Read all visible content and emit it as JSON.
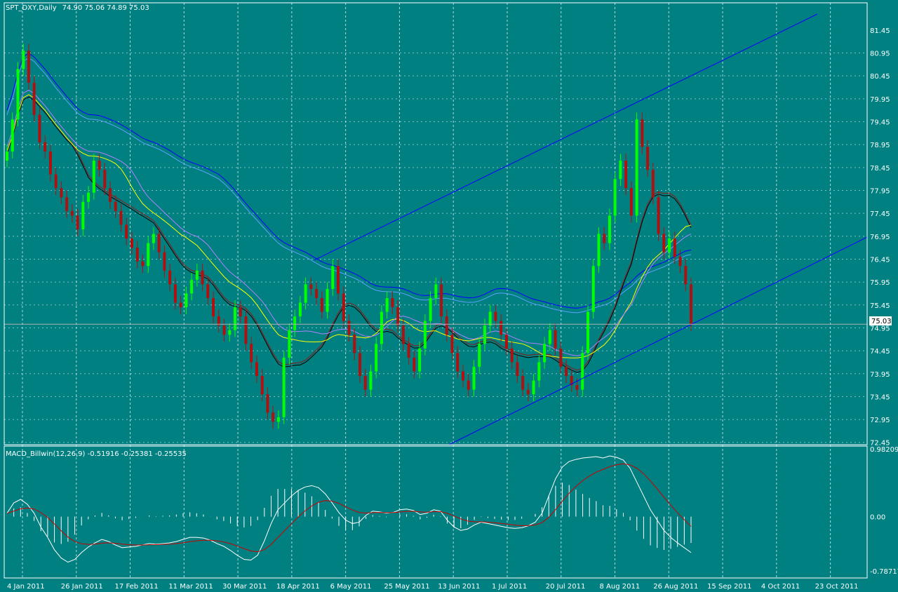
{
  "main_header": {
    "symbol": "SPT_DXY,Daily",
    "ohlc": "74.90 75.06 74.89 75.03"
  },
  "macd_header": {
    "label": "MACD_Billwin(12,26,9) -0.51916 -0.25381 -0.25535"
  },
  "price_marker": "75.03",
  "colors": {
    "background": "#008080",
    "bull_candle": "#00ff00",
    "bear_candle": "#b01010",
    "ma_yellow": "#ffff00",
    "ma_violet": "#b080ff",
    "ma_black": "#000000",
    "ma_darkred": "#8b1a1a",
    "ma_blue": "#0000ff",
    "ma_lightblue": "#60a0ff",
    "trendline": "#0000ff",
    "grid": "#ffffff",
    "macd_line": "#ffffff",
    "signal_line": "#cc0000",
    "histogram": "#ffffff"
  },
  "chart_data": [
    {
      "type": "candlestick",
      "title": "SPT_DXY,Daily",
      "y_ticks": [
        "81.45",
        "80.95",
        "80.45",
        "79.95",
        "79.45",
        "78.95",
        "78.45",
        "77.95",
        "77.45",
        "76.95",
        "76.45",
        "75.95",
        "75.45",
        "74.95",
        "74.45",
        "73.95",
        "73.45",
        "72.95",
        "72.45"
      ],
      "ylim": [
        72.4,
        81.8
      ],
      "x_ticks": [
        "4 Jan 2011",
        "26 Jan 2011",
        "17 Feb 2011",
        "11 Mar 2011",
        "30 Mar 2011",
        "18 Apr 2011",
        "6 May 2011",
        "25 May 2011",
        "13 Jun 2011",
        "1 Jul 2011",
        "20 Jul 2011",
        "8 Aug 2011",
        "26 Aug 2011",
        "15 Sep 2011",
        "4 Oct 2011",
        "23 Oct 2011"
      ],
      "last_price": 75.03,
      "closes": [
        78.8,
        79.5,
        80.6,
        81.0,
        80.3,
        79.6,
        79.0,
        78.8,
        78.3,
        78.0,
        77.8,
        77.5,
        77.4,
        77.1,
        77.7,
        77.9,
        78.6,
        78.4,
        78.0,
        77.7,
        77.5,
        77.2,
        76.9,
        76.7,
        76.4,
        76.3,
        76.8,
        77.0,
        76.6,
        76.2,
        75.9,
        75.5,
        75.4,
        75.7,
        76.0,
        76.2,
        75.9,
        75.6,
        75.2,
        75.0,
        74.8,
        74.9,
        75.4,
        75.2,
        74.6,
        74.2,
        73.9,
        73.5,
        73.1,
        72.9,
        73.0,
        74.3,
        74.9,
        75.2,
        75.5,
        75.9,
        75.8,
        75.6,
        75.3,
        75.8,
        76.3,
        75.7,
        75.1,
        74.8,
        74.4,
        73.9,
        73.6,
        74.0,
        74.6,
        75.3,
        75.6,
        75.4,
        75.0,
        74.6,
        74.3,
        74.0,
        74.5,
        75.1,
        75.6,
        75.9,
        75.2,
        74.8,
        74.4,
        74.0,
        73.8,
        73.6,
        74.1,
        74.6,
        75.0,
        75.3,
        75.1,
        74.8,
        74.5,
        74.2,
        73.9,
        73.6,
        73.5,
        73.8,
        74.2,
        74.6,
        74.9,
        74.5,
        74.1,
        73.9,
        73.7,
        73.6,
        74.4,
        75.3,
        76.3,
        77.0,
        76.8,
        77.4,
        78.2,
        78.6,
        78.0,
        77.4,
        79.5,
        78.9,
        78.4,
        77.8,
        77.0,
        76.6,
        76.9,
        76.5,
        76.3,
        75.9,
        75.03
      ]
    },
    {
      "type": "macd",
      "title": "MACD_Billwin(12,26,9) -0.51916 -0.25381 -0.25535",
      "y_ticks": [
        "0.98209",
        "0.00",
        "-0.78717"
      ],
      "ylim": [
        -0.78717,
        0.98209
      ],
      "macd": [
        0.05,
        0.2,
        0.25,
        0.18,
        0.05,
        -0.15,
        -0.3,
        -0.48,
        -0.6,
        -0.66,
        -0.62,
        -0.52,
        -0.44,
        -0.38,
        -0.33,
        -0.36,
        -0.41,
        -0.45,
        -0.44,
        -0.43,
        -0.41,
        -0.39,
        -0.4,
        -0.39,
        -0.38,
        -0.36,
        -0.33,
        -0.3,
        -0.3,
        -0.31,
        -0.34,
        -0.39,
        -0.43,
        -0.49,
        -0.56,
        -0.62,
        -0.63,
        -0.56,
        -0.35,
        -0.1,
        0.1,
        0.2,
        0.3,
        0.38,
        0.43,
        0.45,
        0.42,
        0.33,
        0.2,
        0.06,
        -0.05,
        -0.1,
        -0.08,
        0.02,
        0.08,
        0.07,
        0.05,
        0.06,
        0.1,
        0.11,
        0.09,
        0.03,
        0.05,
        0.1,
        0.08,
        -0.05,
        -0.15,
        -0.2,
        -0.18,
        -0.12,
        -0.08,
        -0.1,
        -0.12,
        -0.14,
        -0.16,
        -0.17,
        -0.16,
        -0.13,
        -0.08,
        0.05,
        0.3,
        0.55,
        0.72,
        0.8,
        0.83,
        0.85,
        0.86,
        0.87,
        0.85,
        0.88,
        0.86,
        0.82,
        0.7,
        0.5,
        0.3,
        0.1,
        -0.05,
        -0.2,
        -0.3,
        -0.38,
        -0.45,
        -0.52
      ]
    }
  ]
}
